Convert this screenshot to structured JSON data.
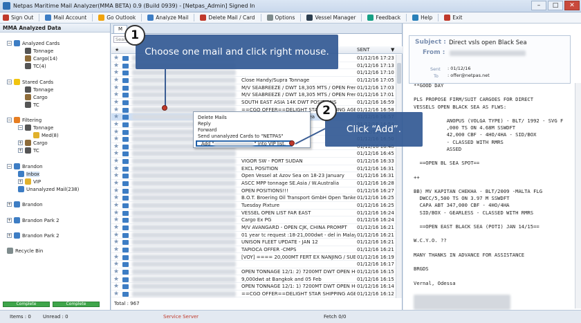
{
  "window": {
    "title": "Netpas Maritime Mail Analyzer(MMA BETA) 0.9 (Build 0939) - [Netpas_Admin] Signed In",
    "minimize": "–",
    "maximize": "□",
    "close": "✕"
  },
  "toolbar": {
    "items": [
      {
        "label": "Sign Out",
        "icon": "sign-out-icon",
        "color": "#c0392b"
      },
      {
        "label": "Mail Account",
        "icon": "mail-account-icon",
        "color": "#3d7dc4"
      },
      {
        "label": "Go Outlook",
        "icon": "outlook-icon",
        "color": "#f0a30a"
      },
      {
        "label": "Analyze Mail",
        "icon": "analyze-icon",
        "color": "#3d7dc4"
      },
      {
        "label": "Delete Mail / Card",
        "icon": "delete-icon",
        "color": "#c0392b"
      },
      {
        "label": "Options",
        "icon": "gear-icon",
        "color": "#7f8c8d"
      },
      {
        "label": "Vessel Manager",
        "icon": "ship-icon",
        "color": "#2c3e50"
      },
      {
        "label": "Feedback",
        "icon": "feedback-icon",
        "color": "#16a085"
      },
      {
        "label": "Help",
        "icon": "help-icon",
        "color": "#2980b9"
      },
      {
        "label": "Exit",
        "icon": "exit-icon",
        "color": "#c0392b"
      }
    ]
  },
  "left": {
    "header": "MMA Analyzed Data",
    "nodes": [
      {
        "label": "Analyzed Cards",
        "expander": "−",
        "icon": "cards-icon",
        "color": "#3d7dc4"
      },
      {
        "label": "Tonnage",
        "expander": "",
        "icon": "ship-icon",
        "color": "#555555"
      },
      {
        "label": "Cargo(14)",
        "expander": "",
        "icon": "cargo-icon",
        "color": "#8e6c3a"
      },
      {
        "label": "TC(4)",
        "expander": "",
        "icon": "tc-icon",
        "color": "#555555"
      },
      {
        "label": "Stared Cards",
        "expander": "−",
        "icon": "star-icon",
        "color": "#f1c40f"
      },
      {
        "label": "Tonnage",
        "expander": "",
        "icon": "ship-icon",
        "color": "#555555"
      },
      {
        "label": "Cargo",
        "expander": "",
        "icon": "cargo-icon",
        "color": "#8e6c3a"
      },
      {
        "label": "TC",
        "expander": "",
        "icon": "tc-icon",
        "color": "#555555"
      },
      {
        "label": "Filtering",
        "expander": "−",
        "icon": "filter-icon",
        "color": "#e67e22"
      },
      {
        "label": "Tonnage",
        "expander": "−",
        "icon": "ship-icon",
        "color": "#555555"
      },
      {
        "label": "Med(8)",
        "expander": "",
        "icon": "folder-icon",
        "color": "#e1b12c"
      },
      {
        "label": "Cargo",
        "expander": "+",
        "icon": "cargo-icon",
        "color": "#8e6c3a"
      },
      {
        "label": "TC",
        "expander": "+",
        "icon": "tc-icon",
        "color": "#555555"
      },
      {
        "label": "Brandon",
        "expander": "−",
        "icon": "account-icon",
        "color": "#3d7dc4"
      },
      {
        "label": "Inbox",
        "expander": "",
        "icon": "inbox-icon",
        "color": "#3d7dc4"
      },
      {
        "label": "VIP",
        "expander": "+",
        "icon": "folder-icon",
        "color": "#e1b12c"
      },
      {
        "label": "Unanalyzed Mail(238)",
        "expander": "",
        "icon": "mail-icon",
        "color": "#3d7dc4"
      },
      {
        "label": "Brandon",
        "expander": "+",
        "icon": "account-icon",
        "color": "#3d7dc4"
      },
      {
        "label": "Brandon Park 2",
        "expander": "+",
        "icon": "account-icon",
        "color": "#3d7dc4"
      },
      {
        "label": "Brandon Park 2",
        "expander": "+",
        "icon": "account-icon",
        "color": "#3d7dc4"
      },
      {
        "label": "Recycle Bin",
        "expander": "",
        "icon": "recycle-bin-icon",
        "color": "#7f8c8d"
      }
    ],
    "progress": [
      "Complete",
      "Complete"
    ]
  },
  "center": {
    "tab": "M",
    "search_placeholder": "Search",
    "columns": {
      "sent": "SENT"
    },
    "rows": [
      {
        "subject": "",
        "sent": "01/12/16 17:23"
      },
      {
        "subject": "",
        "sent": "01/12/16 17:13"
      },
      {
        "subject": "",
        "sent": "01/12/16 17:10"
      },
      {
        "subject": "Close Handy/Supra Tonnage",
        "sent": "01/12/16 17:05"
      },
      {
        "subject": "M/V SEABREEZE / DWT 18,305 MTS / OPEN French Bay",
        "sent": "01/12/16 17:03"
      },
      {
        "subject": "M/V SEABREEZE / DWT 18,305 MTS / OPEN French Bay",
        "sent": "01/12/16 17:01"
      },
      {
        "subject": "SOUTH EAST ASIA 14K DWT POSITIONS",
        "sent": "01/12/16 16:59"
      },
      {
        "subject": "==CGO OFFER==DELIGHT STAR SHIPPING AGENCY",
        "sent": "01/12/16 16:58"
      },
      {
        "subject": "Standby Ideas open Black Sea",
        "sent": "01/12/16 16:57"
      },
      {
        "subject": "",
        "sent": "01/12/16 16:54"
      },
      {
        "subject": "",
        "sent": "01/12/16 16:52"
      },
      {
        "subject": "",
        "sent": "01/12/16 16:50"
      },
      {
        "subject": "",
        "sent": "01/12/16 16:48"
      },
      {
        "subject": "",
        "sent": "01/12/16 16:45"
      },
      {
        "subject": "VIGOR SW - PORT SUDAN",
        "sent": "01/12/16 16:33"
      },
      {
        "subject": "EXCL POSITION",
        "sent": "01/12/16 16:31"
      },
      {
        "subject": "Open Vessel at Azov Sea on 18-23 January",
        "sent": "01/12/16 16:31"
      },
      {
        "subject": "ASCC MPP tonnage SE.Asia / W.Australia",
        "sent": "01/12/16 16:28"
      },
      {
        "subject": "OPEN POSITIONS!!!",
        "sent": "01/12/16 16:27"
      },
      {
        "subject": "B.O.T. Broering Oil Transport GmbH Open Tanker Position",
        "sent": "01/12/16 16:25"
      },
      {
        "subject": "Tuesday Pixture",
        "sent": "01/12/16 16:25"
      },
      {
        "subject": "VESSEL OPEN LIST FAR EAST",
        "sent": "01/12/16 16:24"
      },
      {
        "subject": "Cargo Ex PG",
        "sent": "01/12/16 16:24"
      },
      {
        "subject": "M/V AVANGARD - OPEN CJK, CHINA PROMPT",
        "sent": "01/12/16 16:21"
      },
      {
        "subject": "01 year tc request :18-21,000dwt - del in Malaysia-Spore",
        "sent": "01/12/16 16:21"
      },
      {
        "subject": "UNISON FLEET UPDATE - JAN 12",
        "sent": "01/12/16 16:21"
      },
      {
        "subject": "TAPIOCA OFFER -CMPS",
        "sent": "01/12/16 16:21"
      },
      {
        "subject": "[VOY] ==== 20,000MT FERT EX NANJING / SUBIC",
        "sent": "01/12/16 16:19"
      },
      {
        "subject": "",
        "sent": "01/12/16 16:17"
      },
      {
        "subject": "OPEN TONNAGE 12/1: 2) 7200MT DWT OPEN HONGKONG",
        "sent": "01/12/16 16:15"
      },
      {
        "subject": "9,000dwt at Bangkok and 05 Feb",
        "sent": "01/12/16 16:15"
      },
      {
        "subject": "OPEN TONNAGE 12/1: 1) 7200MT DWT OPEN HONGKONG",
        "sent": "01/12/16 16:14"
      },
      {
        "subject": "==CGO OFFER==DELIGHT STAR SHIPPING AGENCY",
        "sent": "01/12/16 16:12"
      }
    ],
    "total": "Total : 967"
  },
  "context_menu": {
    "items": [
      "Delete Mails",
      "Reply",
      "Forward",
      "Send unanalyzed Cards to \"NETPAS\""
    ],
    "add_prefix": "Add \"",
    "add_suffix": "\" into VIP list."
  },
  "right": {
    "subject_label": "Subject :",
    "subject_value": "Direct vsls open Black Sea",
    "from_label": "From :",
    "sent_label": "Sent",
    "sent_value": ": 01/12/16",
    "to_label": "To",
    "to_value": ": offer@netpas.net",
    "body": "**GOOD DAY\n\nPLS PROPOSE FIRM/SUIT CARGOES FOR DIRECT\nVESSELS OPEN BLACK SEA AS FLWS:\n\n           ANOPUS (VOLGA TYPE) - BLT/ 1992 - SVG F\n           ,000 TS ON 4.68M SSWDFT\n           42,000 CBF - 4HO/4HA - SID/BOX\n           - CLASSED WITH RMRS\n           ASSED\n\n  ==OPEN BL SEA SPOT==\n\n++\n\nBB) MV KAPITAN CHEKHA - BLT/2009 -MALTA FLG\n  DWCC/5,500 TS ON 3.97 M SSWDFT\n  CAPA ABT 347,000 CBF - 4HO/4HA\n  SID/BOX - GEARLESS - CLASSED WITH RMRS\n\n  ==OPEN EAST BLACK SEA (POTI) JAN 14/15==\n\nW.C.Y.O. ??\n\nMANY THANKS IN ADVANCE FOR ASSISTANCE\n\nBRGDS\n\nVernal, Odessa"
  },
  "status": {
    "items": "Items : 0",
    "unread": "Unread : 0",
    "service": "Service Server",
    "fetch": "Fetch 0/0"
  },
  "annotations": {
    "step1_number": "1",
    "step1_text": "Choose one mail and click right mouse.",
    "step2_number": "2",
    "step2_text": "Click “Add”."
  }
}
